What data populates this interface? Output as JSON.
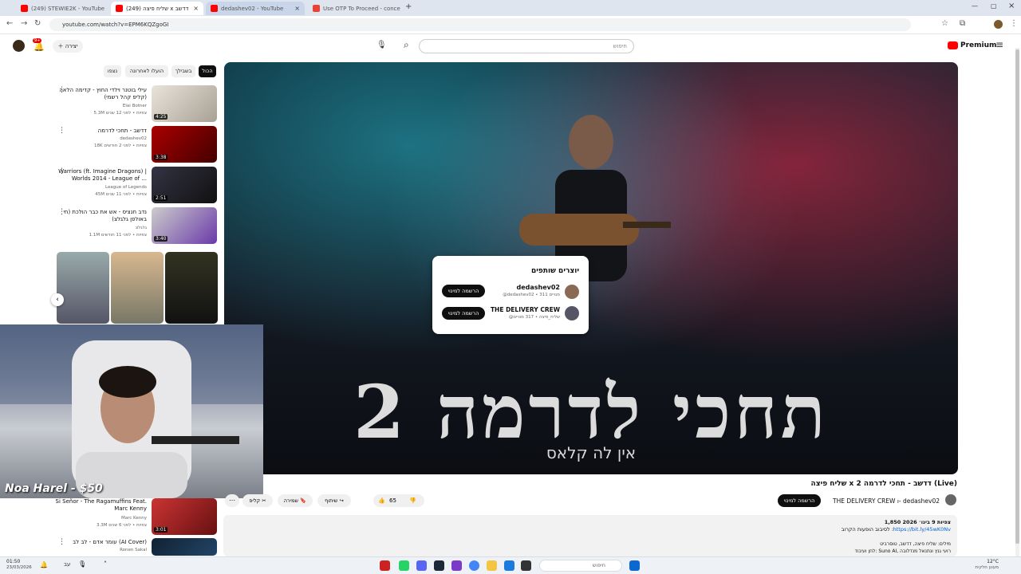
{
  "browser": {
    "tabs": [
      {
        "title": "(249) STEWIE2K - YouTube",
        "close": "×"
      },
      {
        "title": "(249) שליח פיצה x דדשב",
        "close": "×"
      },
      {
        "title": "dedashev02 - YouTube",
        "close": "×"
      },
      {
        "title": "Use OTP To Proceed - concema",
        "close": "×"
      }
    ],
    "new_tab": "+",
    "url": "youtube.com/watch?v=EPM6KQZgoGI",
    "window_controls": [
      "—",
      "▢",
      "×"
    ]
  },
  "youtube": {
    "logo": "Premium",
    "search_placeholder": "חיפוש",
    "create_label": "יצירה",
    "notif_count": "9+"
  },
  "player": {
    "big_title": "תחכי לדרמה 2",
    "subtitle": "אין לה קלאס"
  },
  "collab_popup": {
    "title": "יוצרים שותפים",
    "creators": [
      {
        "name": "dedashev02",
        "meta": "@dedashev02 • 311 מנויים",
        "subscribe": "הרשמה למינוי"
      },
      {
        "name": "THE DELIVERY CREW",
        "meta": "@שליח_פיצה • 317 מנויים",
        "subscribe": "הרשמה למינוי"
      }
    ]
  },
  "filters": [
    "הכול",
    "בשבילך",
    "הועלו לאחרונה",
    "נצפו"
  ],
  "recommendations": [
    {
      "title": "עילי בוטנר וילדי החוץ - קדימה הלאה (קליפ קהל רשמי)",
      "channel": "Elai Botner",
      "meta": "5.3M צפיות • לפני 12 שנים",
      "duration": "4:25"
    },
    {
      "title": "דדשב - תחכי לדרמה",
      "channel": "dedashev02",
      "meta": "18K צפיות • לפני 2 חודשים",
      "duration": "3:38"
    },
    {
      "title": "Warriors (ft. Imagine Dragons) | Worlds 2014 - League of ...",
      "channel": "League of Legends",
      "meta": "45M צפיות • לפני 11 שנים",
      "duration": "2:51"
    },
    {
      "title": "נדב חנציס - אש את כבר הולכת (חי באולפן גלגלצ)",
      "channel": "גלגלצ",
      "meta": "1.1M צפיות • לפני 11 חודשים",
      "duration": "3:40"
    },
    {
      "title": "Si Señor - The Ragamuffins Feat. Marc Kenny",
      "channel": "Marc Kenny",
      "meta": "3.3M צפיות • לפני 6 שנים",
      "duration": "3:01"
    },
    {
      "title": "עומר אדם - לב לב (AI Cover)",
      "channel": "Ronen Sakal",
      "meta": "",
      "duration": ""
    }
  ],
  "webcam": {
    "donation": "Noa Harel - $50"
  },
  "video": {
    "title": "שליח פיצה x דדשב - תחכי לדרמה 2 (Live)",
    "channel_line": "THE DELIVERY CREW ו- dedashev02",
    "subscribe": "הרשמה למינוי",
    "likes": "65",
    "share": "שיתוף",
    "save": "שמירה",
    "clip": "קליפ",
    "more": "⋯",
    "views_line": "1,850 צפיות  9 בינו׳ 2026",
    "desc_link": "https://bit.ly/45wK0Nv",
    "desc_text": "לסיבוב הופעות הקרוב :",
    "credits": "מילים: שליח פיצה, דדשב, טוסרביט",
    "credits2": "לחן ועיבוד: Suno AI, רועי גנץ ונתנאל מנדלובה"
  },
  "taskbar": {
    "time": "01:50",
    "date": "23/03/2026",
    "weather_temp": "12°C",
    "weather_desc": "מעונן חלקית",
    "search_placeholder": "חיפוש",
    "lang": "עב"
  },
  "colors": {
    "yt_red": "#ff0000",
    "black": "#0f0f0f",
    "chip_bg": "#f0f0f0"
  }
}
